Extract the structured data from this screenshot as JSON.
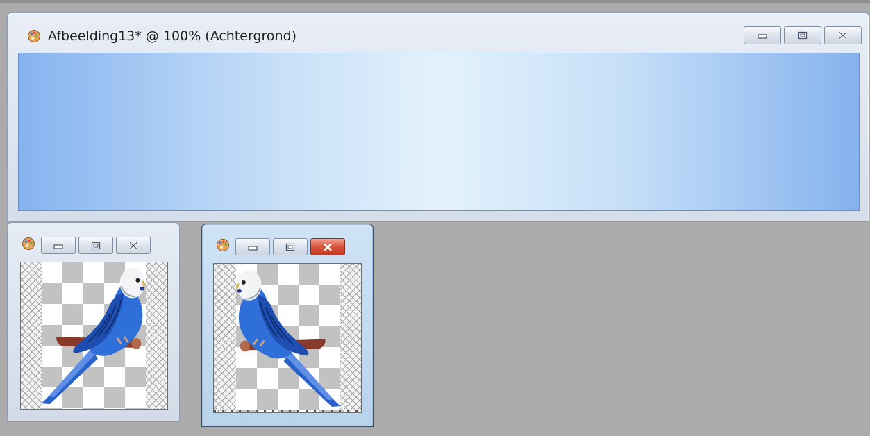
{
  "main_window": {
    "title": "Afbeelding13* @ 100% (Achtergrond)",
    "controls": [
      "minimize",
      "restore",
      "close"
    ]
  },
  "thumbnail_windows": [
    {
      "id": "left",
      "active": false,
      "content": "parakeet-facing-right"
    },
    {
      "id": "right",
      "active": true,
      "content": "parakeet-facing-left"
    }
  ],
  "icons": {
    "app": "paint-palette-icon",
    "minimize": "minimize-icon",
    "restore": "restore-icon",
    "close": "close-icon"
  },
  "colors": {
    "desktop": "#ababab",
    "window_frame": "#d4dde9",
    "active_frame": "#b9d3ec",
    "gradient_edge": "#86b3ef",
    "gradient_center": "#e4f2fc",
    "close_active": "#d8533d",
    "bird_blue": "#2f6fd9"
  }
}
